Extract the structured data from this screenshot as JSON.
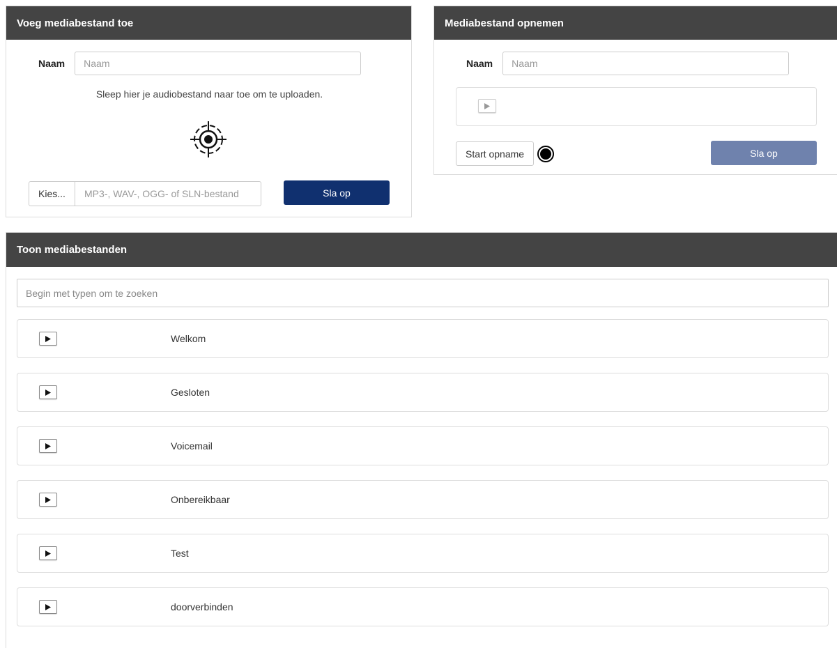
{
  "upload_panel": {
    "title": "Voeg mediabestand toe",
    "name_label": "Naam",
    "name_placeholder": "Naam",
    "drop_text": "Sleep hier je audiobestand naar toe om te uploaden.",
    "choose_label": "Kies...",
    "file_placeholder": "MP3-, WAV-, OGG- of SLN-bestand",
    "save_label": "Sla op",
    "save_color": "#10306f"
  },
  "record_panel": {
    "title": "Mediabestand opnemen",
    "name_label": "Naam",
    "name_placeholder": "Naam",
    "start_label": "Start opname",
    "save_label": "Sla op",
    "save_color": "#6f82ad"
  },
  "list_panel": {
    "title": "Toon mediabestanden",
    "search_placeholder": "Begin met typen om te zoeken",
    "items": [
      {
        "name": "Welkom"
      },
      {
        "name": "Gesloten"
      },
      {
        "name": "Voicemail"
      },
      {
        "name": "Onbereikbaar"
      },
      {
        "name": "Test"
      },
      {
        "name": "doorverbinden"
      }
    ]
  },
  "colors": {
    "header_bg": "#444444",
    "primary": "#10306f",
    "primary_disabled": "#6f82ad"
  },
  "icons": {
    "drop_target": "crosshair-target-icon",
    "play": "play-icon",
    "record": "record-icon"
  }
}
